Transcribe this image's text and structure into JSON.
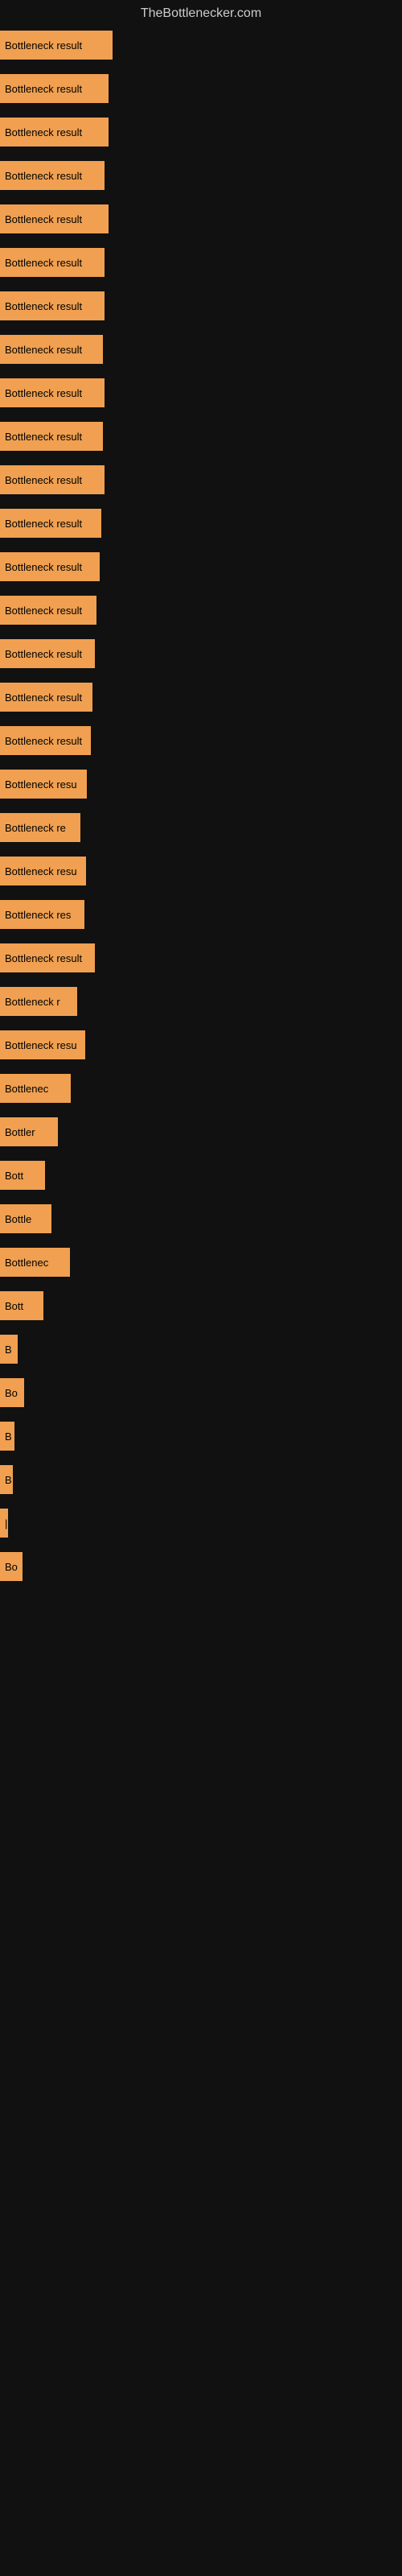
{
  "site": {
    "title": "TheBottlenecker.com"
  },
  "bars": [
    {
      "label": "Bottleneck result",
      "width": 140
    },
    {
      "label": "Bottleneck result",
      "width": 135
    },
    {
      "label": "Bottleneck result",
      "width": 135
    },
    {
      "label": "Bottleneck result",
      "width": 130
    },
    {
      "label": "Bottleneck result",
      "width": 135
    },
    {
      "label": "Bottleneck result",
      "width": 130
    },
    {
      "label": "Bottleneck result",
      "width": 130
    },
    {
      "label": "Bottleneck result",
      "width": 128
    },
    {
      "label": "Bottleneck result",
      "width": 130
    },
    {
      "label": "Bottleneck result",
      "width": 128
    },
    {
      "label": "Bottleneck result",
      "width": 130
    },
    {
      "label": "Bottleneck result",
      "width": 126
    },
    {
      "label": "Bottleneck result",
      "width": 124
    },
    {
      "label": "Bottleneck result",
      "width": 120
    },
    {
      "label": "Bottleneck result",
      "width": 118
    },
    {
      "label": "Bottleneck result",
      "width": 115
    },
    {
      "label": "Bottleneck result",
      "width": 113
    },
    {
      "label": "Bottleneck resu",
      "width": 108
    },
    {
      "label": "Bottleneck re",
      "width": 100
    },
    {
      "label": "Bottleneck resu",
      "width": 107
    },
    {
      "label": "Bottleneck res",
      "width": 105
    },
    {
      "label": "Bottleneck result",
      "width": 118
    },
    {
      "label": "Bottleneck r",
      "width": 96
    },
    {
      "label": "Bottleneck resu",
      "width": 106
    },
    {
      "label": "Bottlenec",
      "width": 88
    },
    {
      "label": "Bottler",
      "width": 72
    },
    {
      "label": "Bott",
      "width": 56
    },
    {
      "label": "Bottle",
      "width": 64
    },
    {
      "label": "Bottlenec",
      "width": 87
    },
    {
      "label": "Bott",
      "width": 54
    },
    {
      "label": "B",
      "width": 22
    },
    {
      "label": "Bo",
      "width": 30
    },
    {
      "label": "B",
      "width": 18
    },
    {
      "label": "B",
      "width": 16
    },
    {
      "label": "|",
      "width": 10
    },
    {
      "label": "Bo",
      "width": 28
    }
  ]
}
